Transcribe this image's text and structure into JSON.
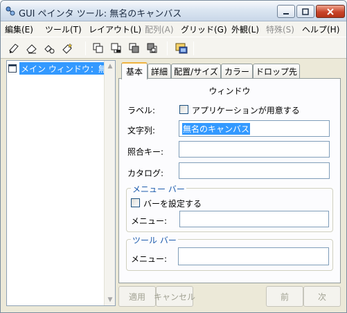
{
  "window": {
    "title": "GUI ペインタ ツール: 無名のキャンバス"
  },
  "menu": [
    {
      "label": "編集(E)",
      "disabled": false
    },
    {
      "label": "ツール(T)",
      "disabled": false
    },
    {
      "label": "レイアウト(L)",
      "disabled": false
    },
    {
      "label": "配列(A)",
      "disabled": true
    },
    {
      "label": "グリッド(G)",
      "disabled": false
    },
    {
      "label": "外観(L)",
      "disabled": false
    },
    {
      "label": "特殊(S)",
      "disabled": true
    },
    {
      "label": "ヘルプ(H)",
      "disabled": false
    }
  ],
  "toolbar": {
    "icons": [
      "pointer-tool-icon",
      "eraser-tool-icon",
      "group-select-icon",
      "magic-select-icon",
      "bring-front-icon",
      "send-back-icon",
      "move-forward-icon",
      "move-backward-icon",
      "preview-icon"
    ]
  },
  "tree": {
    "item_label": "メイン ウィンドウ：無"
  },
  "tabs": [
    "基本",
    "詳細",
    "配置/サイズ",
    "カラー",
    "ドロップ先"
  ],
  "panel": {
    "heading": "ウィンドウ",
    "label_label": "ラベル:",
    "app_default_checkbox": "アプリケーションが用意する",
    "string_label": "文字列:",
    "string_value": "無名のキャンバス",
    "ref_key_label": "照合キー:",
    "ref_key_value": "",
    "catalog_label": "カタログ:",
    "catalog_value": "",
    "menubar_group": {
      "title": "メニュー バー",
      "set_checkbox": "バーを設定する",
      "menu_label": "メニュー:",
      "menu_value": ""
    },
    "toolbar_group": {
      "title": "ツール バー",
      "menu_label": "メニュー:",
      "menu_value": ""
    }
  },
  "buttons": {
    "apply": "適用",
    "cancel": "キャンセル",
    "prev": "前",
    "next": "次"
  },
  "colors": {
    "selection": "#3399ff",
    "group_title": "#1b5aac",
    "active_tab_accent": "#f0b33e"
  }
}
